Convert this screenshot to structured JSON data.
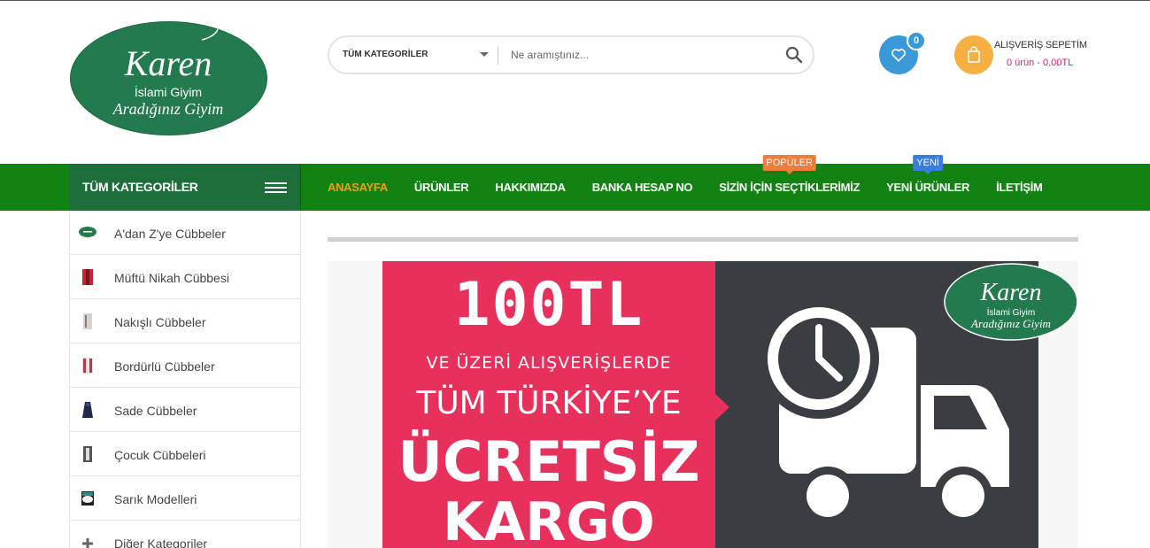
{
  "brand": {
    "logo_name": "Karen",
    "logo_line1": "İslami Giyim",
    "logo_line2": "Aradığınız Giyim"
  },
  "search": {
    "category_label": "TÜM KATEGORİLER",
    "placeholder": "Ne aramıştınız..."
  },
  "wishlist": {
    "count": "0"
  },
  "cart": {
    "title": "ALIŞVERİŞ SEPETİM",
    "summary": "0 ürün - 0,00TL"
  },
  "categories_header": {
    "label": "TÜM KATEGORİLER"
  },
  "nav": {
    "items": [
      {
        "label": "ANASAYFA"
      },
      {
        "label": "ÜRÜNLER"
      },
      {
        "label": "HAKKIMIZDA"
      },
      {
        "label": "BANKA HESAP NO"
      },
      {
        "label": "SİZİN İÇİN SEÇTİKLERİMİZ",
        "badge": "POPÜLER"
      },
      {
        "label": "YENİ ÜRÜNLER",
        "badge": "YENİ"
      },
      {
        "label": "İLETİŞİM"
      }
    ]
  },
  "sidebar": {
    "items": [
      {
        "label": "A'dan Z'ye Cübbeler"
      },
      {
        "label": "Müftü Nikah Cübbesi"
      },
      {
        "label": "Nakışlı Cübbeler"
      },
      {
        "label": "Bordürlü Cübbeler"
      },
      {
        "label": "Sade Cübbeler"
      },
      {
        "label": "Çocuk Cübbeleri"
      },
      {
        "label": "Sarık Modelleri"
      },
      {
        "label": "Diğer Kategoriler"
      }
    ]
  },
  "banner": {
    "line1": "100TL",
    "line2": "VE ÜZERİ ALIŞVERİŞLERDE",
    "line3": "TÜM TÜRKİYE’YE",
    "line4": "ÜCRETSİZ",
    "line5": "KARGO"
  },
  "colors": {
    "nav_green": "#128312",
    "category_green": "#1e6e3a",
    "active_nav": "#f39c12",
    "wishlist_blue": "#3a9ad9",
    "cart_orange": "#f5b041",
    "banner_pink": "#e8305c",
    "banner_dark": "#3a3d42"
  }
}
